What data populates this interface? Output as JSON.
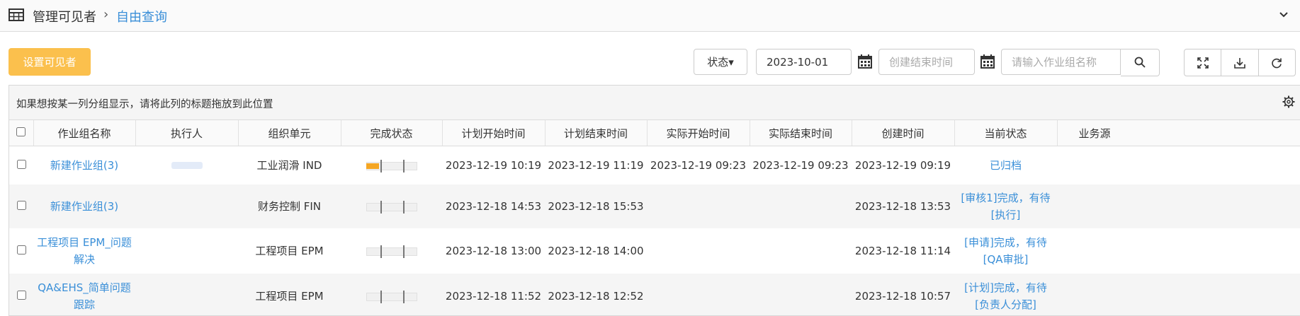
{
  "breadcrumb": {
    "root": "管理可见者",
    "separator": "›",
    "current": "自由查询"
  },
  "toolbar": {
    "set_visible_label": "设置可见者",
    "status_label": "状态▾",
    "start_date_value": "2023-10-01",
    "end_date_placeholder": "创建结束时间",
    "search_placeholder": "请输入作业组名称"
  },
  "grid": {
    "group_hint": "如果想按某一列分组显示，请将此列的标题拖放到此位置",
    "columns": [
      "作业组名称",
      "执行人",
      "组织单元",
      "完成状态",
      "计划开始时间",
      "计划结束时间",
      "实际开始时间",
      "实际结束时间",
      "创建时间",
      "当前状态",
      "业务源"
    ],
    "rows": [
      {
        "name": "新建作业组(3)",
        "executor": "",
        "org": "工业润滑 IND",
        "progress": 0.25,
        "plan_start": "2023-12-19 10:19",
        "plan_end": "2023-12-19 11:19",
        "actual_start": "2023-12-19 09:23",
        "actual_end": "2023-12-19 09:23",
        "created": "2023-12-19 09:19",
        "status": "已归档"
      },
      {
        "name": "新建作业组(3)",
        "executor": "",
        "org": "财务控制 FIN",
        "progress": 0,
        "plan_start": "2023-12-18 14:53",
        "plan_end": "2023-12-18 15:53",
        "actual_start": "",
        "actual_end": "",
        "created": "2023-12-18 13:53",
        "status": "[审核1]完成，有待[执行]"
      },
      {
        "name": "工程项目 EPM_问题解决",
        "executor": "",
        "org": "工程项目 EPM",
        "progress": 0,
        "plan_start": "2023-12-18 13:00",
        "plan_end": "2023-12-18 14:00",
        "actual_start": "",
        "actual_end": "",
        "created": "2023-12-18 11:14",
        "status": "[申请]完成，有待[QA审批]"
      },
      {
        "name": "QA&EHS_简单问题跟踪",
        "executor": "",
        "org": "工程项目 EPM",
        "progress": 0,
        "plan_start": "2023-12-18 11:52",
        "plan_end": "2023-12-18 12:52",
        "actual_start": "",
        "actual_end": "",
        "created": "2023-12-18 10:57",
        "status": "[计划]完成，有待[负责人分配]"
      }
    ]
  },
  "colors": {
    "accent": "#3a8fd8",
    "primary_button": "#fbc04d",
    "progress_fill": "#f5a623"
  }
}
